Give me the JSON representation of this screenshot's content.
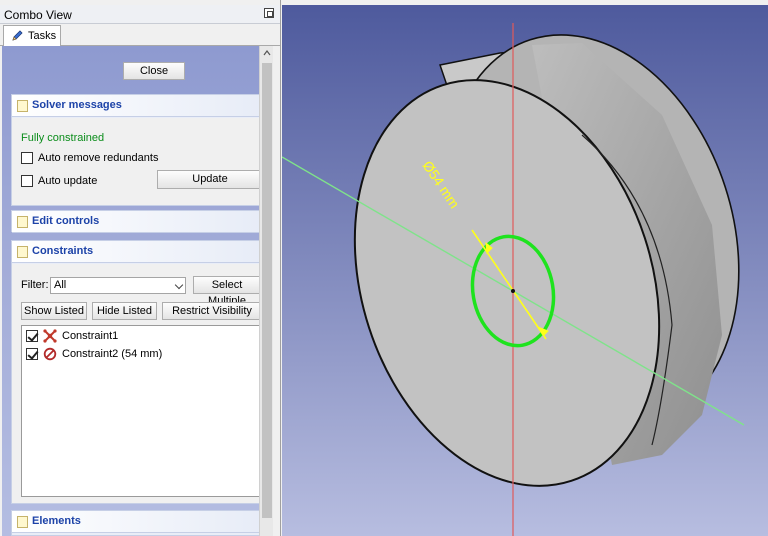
{
  "combo_view": {
    "title": "Combo View",
    "float_icon": "float-window-icon",
    "tab": {
      "label": "Tasks",
      "icon": "pencil-icon"
    }
  },
  "close_label": "Close",
  "solver": {
    "header": "Solver messages",
    "status": "Fully constrained",
    "status_color": "#0b8d1b",
    "auto_remove": {
      "label": "Auto remove redundants",
      "checked": false
    },
    "auto_update": {
      "label": "Auto update",
      "checked": false
    },
    "update_label": "Update"
  },
  "edit_controls": {
    "header": "Edit controls"
  },
  "constraints": {
    "header": "Constraints",
    "filter_label": "Filter:",
    "filter_value": "All",
    "select_multiple": "Select Multiple",
    "show_listed": "Show Listed",
    "hide_listed": "Hide Listed",
    "restrict_visibility": "Restrict Visibility",
    "items": [
      {
        "label": "Constraint1",
        "checked": true,
        "icon": "coincident-constraint-icon"
      },
      {
        "label": "Constraint2 (54 mm)",
        "checked": true,
        "icon": "diameter-constraint-icon"
      }
    ]
  },
  "elements": {
    "header": "Elements"
  },
  "viewport": {
    "dimension_label": "Ø54 mm",
    "background_top": "#4e5a9d",
    "background_bottom": "#b7bde0",
    "circle_color": "#1ee31e",
    "dimension_color": "#ffff1a",
    "axis_x_color": "#7fe38a",
    "axis_y_color": "#e05a5a"
  }
}
